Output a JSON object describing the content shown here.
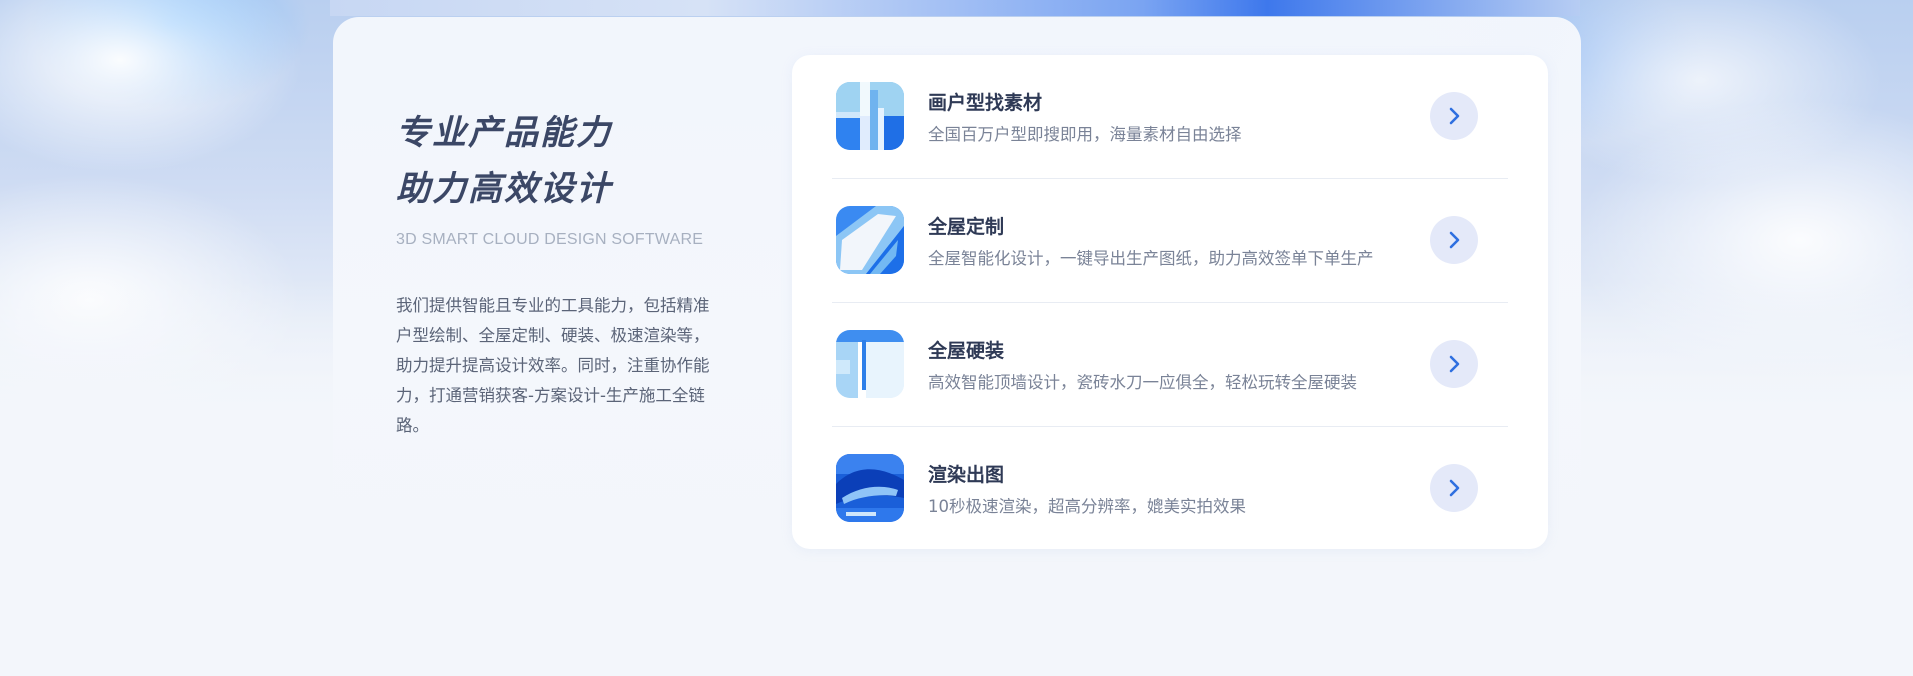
{
  "hero": {
    "title_line1": "专业产品能力",
    "title_line2": "助力高效设计",
    "subtitle": "3D SMART CLOUD DESIGN SOFTWARE",
    "description": "我们提供智能且专业的工具能力，包括精准户型绘制、全屋定制、硬装、极速渲染等，助力提升提高设计效率。同时，注重协作能力，打通营销获客-方案设计-生产施工全链路。"
  },
  "features": [
    {
      "title": "画户型找素材",
      "desc": "全国百万户型即搜即用，海量素材自由选择",
      "icon": "floorplan-thumbnail"
    },
    {
      "title": "全屋定制",
      "desc": "全屋智能化设计，一键导出生产图纸，助力高效签单下单生产",
      "icon": "custom-furniture-thumbnail"
    },
    {
      "title": "全屋硬装",
      "desc": "高效智能顶墙设计，瓷砖水刀一应俱全，轻松玩转全屋硬装",
      "icon": "hard-decoration-thumbnail"
    },
    {
      "title": "渲染出图",
      "desc": "10秒极速渲染，超高分辨率，媲美实拍效果",
      "icon": "render-thumbnail"
    }
  ],
  "colors": {
    "accent": "#2f6fe0",
    "arrow_bg": "#e4e9f9",
    "title": "#3b4766"
  }
}
